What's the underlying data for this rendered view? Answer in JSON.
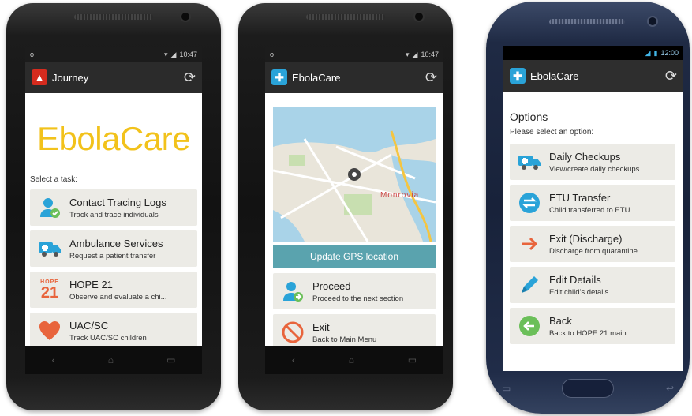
{
  "phone1": {
    "status": {
      "left": "o",
      "time": "10:47"
    },
    "appbar_title": "Journey",
    "logo_text": "EbolaCare",
    "select_label": "Select a task:",
    "tiles": [
      {
        "title": "Contact Tracing Logs",
        "subtitle": "Track and trace individuals",
        "icon": "user-check-icon"
      },
      {
        "title": "Ambulance Services",
        "subtitle": "Request a patient transfer",
        "icon": "ambulance-icon"
      },
      {
        "title": "HOPE 21",
        "subtitle": "Observe and evaluate a chi...",
        "icon": "hope21-icon",
        "badge_small": "HOPE",
        "badge_big": "21"
      },
      {
        "title": "UAC/SC",
        "subtitle": "Track UAC/SC children",
        "icon": "heart-icon"
      }
    ]
  },
  "phone2": {
    "status": {
      "left": "o",
      "time": "10:47"
    },
    "appbar_title": "EbolaCare",
    "map_label": "Monrovia",
    "gps_button": "Update GPS location",
    "tiles": [
      {
        "title": "Proceed",
        "subtitle": "Proceed to the next section",
        "icon": "user-forward-icon"
      },
      {
        "title": "Exit",
        "subtitle": "Back to Main Menu",
        "icon": "no-entry-icon"
      }
    ]
  },
  "phone3": {
    "status": {
      "time": "12:00"
    },
    "appbar_title": "EbolaCare",
    "options_heading": "Options",
    "options_sub": "Please select an option:",
    "tiles": [
      {
        "title": "Daily Checkups",
        "subtitle": "View/create daily checkups",
        "icon": "ambulance-icon"
      },
      {
        "title": "ETU Transfer",
        "subtitle": "Child transferred to ETU",
        "icon": "transfer-icon"
      },
      {
        "title": "Exit (Discharge)",
        "subtitle": "Discharge from quarantine",
        "icon": "arrow-right-icon"
      },
      {
        "title": "Edit Details",
        "subtitle": "Edit child's details",
        "icon": "pencil-icon"
      },
      {
        "title": "Back",
        "subtitle": "Back to HOPE 21 main",
        "icon": "back-arrow-icon"
      }
    ]
  },
  "colors": {
    "accent_yellow": "#f2c21b",
    "accent_blue": "#2aa3d8",
    "accent_red": "#e8643c",
    "gps_button": "#5aa3ae",
    "tile_bg": "#ecebe6"
  }
}
